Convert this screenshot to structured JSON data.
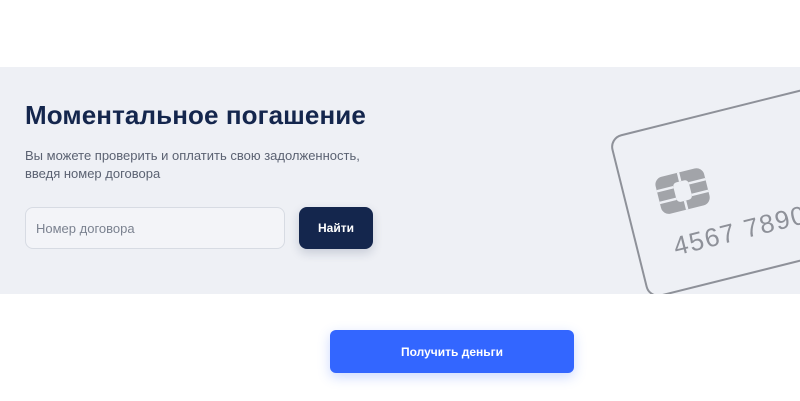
{
  "repayment": {
    "title": "Моментальное погашение",
    "description": "Вы можете проверить и оплатить свою задолженность, введя номер договора",
    "contract_input": {
      "placeholder": "Номер договора",
      "value": ""
    },
    "find_label": "Найти"
  },
  "card": {
    "number_text": "4567 7890"
  },
  "cta": {
    "get_money_label": "Получить деньги"
  },
  "colors": {
    "banner_bg": "#eef0f5",
    "title": "#14264d",
    "find_button": "#14264d",
    "primary_button": "#3366ff"
  }
}
